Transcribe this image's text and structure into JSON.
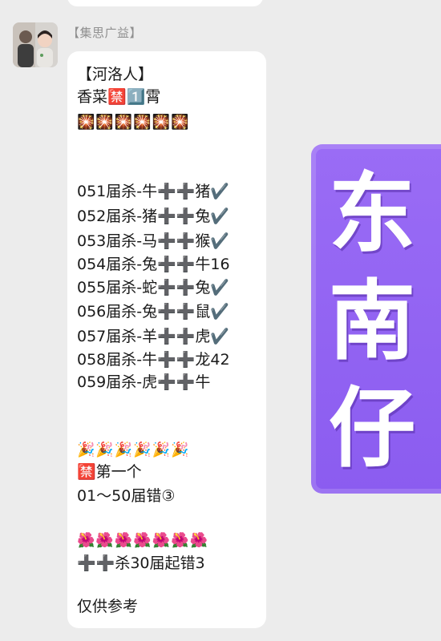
{
  "chat": {
    "sender_name": "【集思广益】",
    "avatar_icon": "person-photo-avatar"
  },
  "message": {
    "lines": [
      "【河洛人】",
      "香菜🈲1️⃣霄",
      "🎇🎇🎇🎇🎇🎇",
      "051届杀-牛➕➕猪✔️",
      "052届杀-猪➕➕兔✔️",
      "053届杀-马➕➕猴✔️",
      "054届杀-兔➕➕牛16",
      "055届杀-蛇➕➕兔✔️",
      "056届杀-兔➕➕鼠✔️",
      "057届杀-羊➕➕虎✔️",
      "058届杀-牛➕➕龙42",
      "059届杀-虎➕➕牛",
      "🎉🎉🎉🎉🎉🎉",
      "🈲第一个",
      "01～50届错③",
      "🌺🌺🌺🌺🌺🌺🌺",
      "➕➕杀30届起错3",
      "仅供参考"
    ]
  },
  "sticker": {
    "chars": [
      "东",
      "南",
      "仔"
    ],
    "color": "#8b5cf0"
  }
}
